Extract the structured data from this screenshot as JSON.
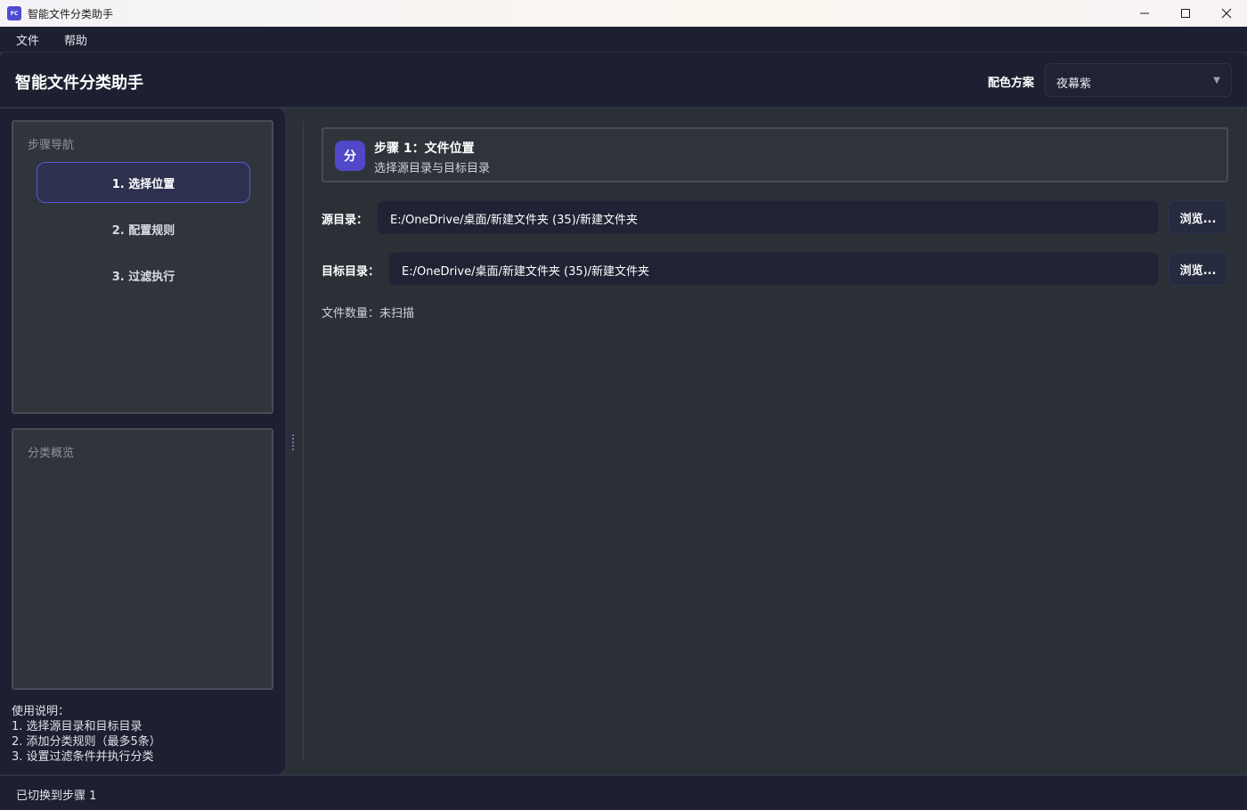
{
  "window": {
    "title": "智能文件分类助手",
    "icon_text": "FC"
  },
  "menu": {
    "file": "文件",
    "help": "帮助"
  },
  "header": {
    "title": "智能文件分类助手",
    "scheme_label": "配色方案",
    "scheme_value": "夜幕紫"
  },
  "sidebar": {
    "nav_title": "步骤导航",
    "steps": [
      {
        "label": "1. 选择位置",
        "active": true
      },
      {
        "label": "2. 配置规则",
        "active": false
      },
      {
        "label": "3. 过滤执行",
        "active": false
      }
    ],
    "overview_title": "分类概览",
    "instructions": [
      "使用说明：",
      "1. 选择源目录和目标目录",
      "2. 添加分类规则（最多5条）",
      "3. 设置过滤条件并执行分类"
    ]
  },
  "main": {
    "step_badge": "分",
    "step_title": "步骤 1：文件位置",
    "step_subtitle": "选择源目录与目标目录",
    "source_label": "源目录：",
    "source_path": "E:/OneDrive/桌面/新建文件夹 (35)/新建文件夹",
    "target_label": "目标目录：",
    "target_path": "E:/OneDrive/桌面/新建文件夹 (35)/新建文件夹",
    "browse_label": "浏览...",
    "file_count": "文件数量：未扫描"
  },
  "status": {
    "text": "已切换到步骤 1"
  },
  "colors": {
    "accent": "#5048c8",
    "active_border": "#5b57d8",
    "panel_bg": "#1c2030",
    "main_bg": "#2b3036"
  }
}
